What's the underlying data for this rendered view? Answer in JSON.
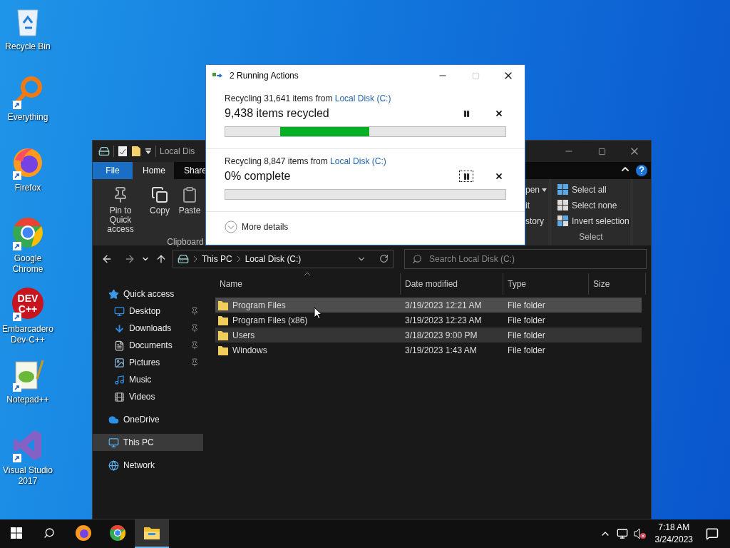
{
  "desktop_icons": [
    {
      "label": "Recycle Bin",
      "kind": "recycle",
      "shortcut": false
    },
    {
      "label": "Everything",
      "kind": "magnifier",
      "shortcut": true
    },
    {
      "label": "Firefox",
      "kind": "firefox",
      "shortcut": true
    },
    {
      "label": "Google Chrome",
      "kind": "chrome",
      "shortcut": true
    },
    {
      "label": "Embarcadero Dev-C++",
      "kind": "devcpp",
      "shortcut": true,
      "logo_text": [
        "DEV",
        "C++"
      ]
    },
    {
      "label": "Notepad++",
      "kind": "notepad",
      "shortcut": true
    },
    {
      "label": "Visual Studio 2017",
      "kind": "vs",
      "shortcut": true
    }
  ],
  "explorer": {
    "title": "Local Dis",
    "tabs": [
      {
        "label": "File",
        "kind": "file",
        "selected": false
      },
      {
        "label": "Home",
        "kind": "tab",
        "selected": true
      },
      {
        "label": "Share",
        "kind": "tab",
        "selected": false
      }
    ],
    "clipboard": {
      "label": "Clipboard",
      "buttons": [
        {
          "label": "Pin to Quick access",
          "kind": "pin"
        },
        {
          "label": "Copy",
          "kind": "copy"
        },
        {
          "label": "Paste",
          "kind": "paste"
        }
      ]
    },
    "open_group": [
      {
        "label": "pen",
        "caret": true
      },
      {
        "label": "it",
        "caret": false
      },
      {
        "label": "story",
        "caret": false
      }
    ],
    "select": {
      "label": "Select",
      "items": [
        {
          "label": "Select all",
          "kind": "all"
        },
        {
          "label": "Select none",
          "kind": "none"
        },
        {
          "label": "Invert selection",
          "kind": "invert"
        }
      ]
    },
    "address": {
      "crumbs": [
        "This PC",
        "Local Disk (C:)"
      ]
    },
    "search": {
      "placeholder": "Search Local Disk (C:)"
    },
    "navigation": [
      {
        "label": "Quick access",
        "kind": "star",
        "selected": false,
        "children": [
          {
            "label": "Desktop",
            "kind": "desktop",
            "pinned": true,
            "selected": false
          },
          {
            "label": "Downloads",
            "kind": "download",
            "pinned": true,
            "selected": false
          },
          {
            "label": "Documents",
            "kind": "document",
            "pinned": true,
            "selected": false
          },
          {
            "label": "Pictures",
            "kind": "picture",
            "pinned": true,
            "selected": false
          },
          {
            "label": "Music",
            "kind": "music",
            "pinned": false,
            "selected": false
          },
          {
            "label": "Videos",
            "kind": "video",
            "pinned": false,
            "selected": false
          }
        ]
      },
      {
        "label": "OneDrive",
        "kind": "cloud",
        "selected": false
      },
      {
        "label": "This PC",
        "kind": "pc",
        "selected": true
      },
      {
        "label": "Network",
        "kind": "network",
        "selected": false
      }
    ],
    "columns": [
      "Name",
      "Date modified",
      "Type",
      "Size"
    ],
    "rows": [
      {
        "name": "Program Files",
        "date": "3/19/2023 12:21 AM",
        "type": "File folder",
        "selected": true,
        "hovered": true
      },
      {
        "name": "Program Files (x86)",
        "date": "3/19/2023 12:23 AM",
        "type": "File folder",
        "selected": false,
        "hovered": false
      },
      {
        "name": "Users",
        "date": "3/18/2023 9:00 PM",
        "type": "File folder",
        "selected": true,
        "hovered": false
      },
      {
        "name": "Windows",
        "date": "3/19/2023 1:43 AM",
        "type": "File folder",
        "selected": false,
        "hovered": false
      }
    ]
  },
  "dialog": {
    "title": "2 Running Actions",
    "operations": [
      {
        "text": "Recycling 31,641 items from ",
        "link": "Local Disk (C:)",
        "status": "9,438 items recycled",
        "level": 0.32,
        "focused": false
      },
      {
        "text": "Recycling 8,847 items from ",
        "link": "Local Disk (C:)",
        "status": "0% complete",
        "focused": true
      }
    ],
    "more_details": "More details"
  },
  "taskbar": {
    "apps": [
      {
        "kind": "firefox",
        "active": false
      },
      {
        "kind": "chrome",
        "active": false
      },
      {
        "kind": "explorer",
        "active": true
      }
    ],
    "time": "7:18 AM",
    "date": "3/24/2023"
  }
}
